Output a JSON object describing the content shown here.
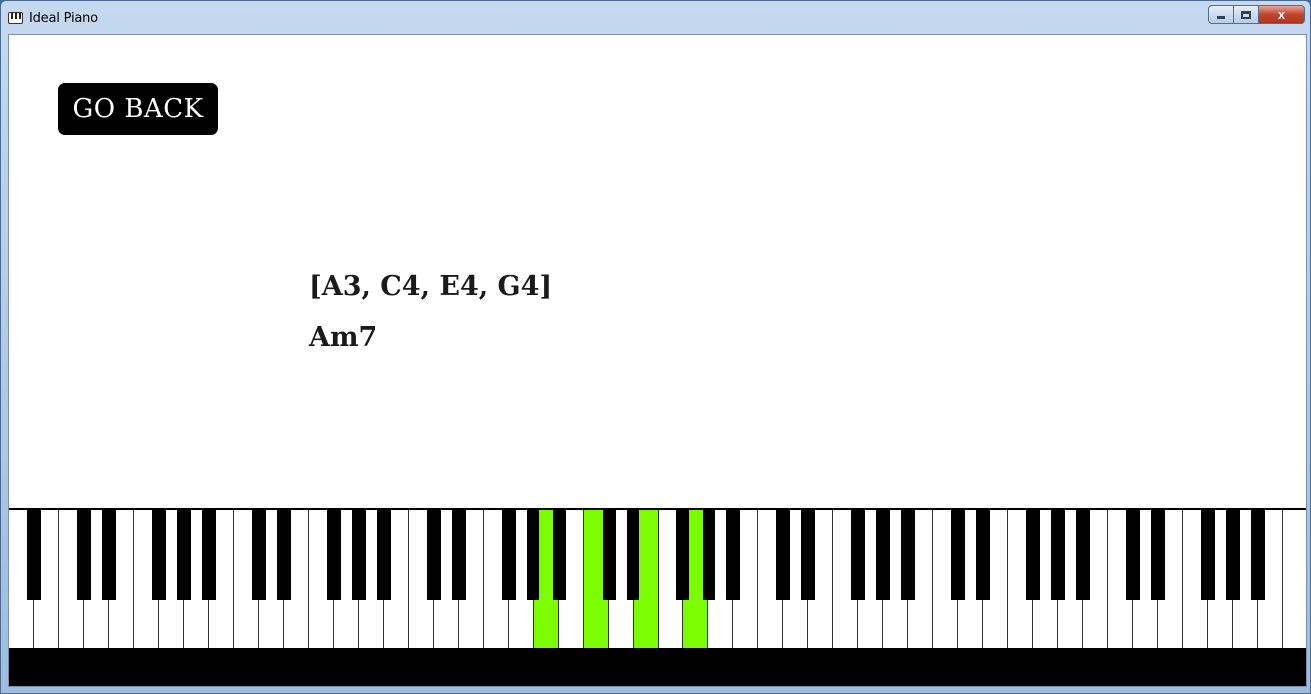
{
  "window": {
    "title": "Ideal Piano",
    "app_icon": "piano-keyboard-icon",
    "controls": {
      "minimize": "minimize-icon",
      "maximize": "maximize-icon",
      "close_label": "x"
    }
  },
  "main": {
    "go_back_label": "GO BACK",
    "notes_label": "[A3, C4, E4, G4]",
    "chord_label": "Am7"
  },
  "keyboard": {
    "white_key_count": 52,
    "highlight_color": "#7cfc00",
    "highlighted_notes": [
      "A3",
      "C4",
      "E4",
      "G4"
    ],
    "highlighted_white_keys": [
      21,
      23,
      25,
      27
    ],
    "highlighted_black_keys": [
      "A3",
      "C4",
      "E4",
      "G4"
    ]
  }
}
